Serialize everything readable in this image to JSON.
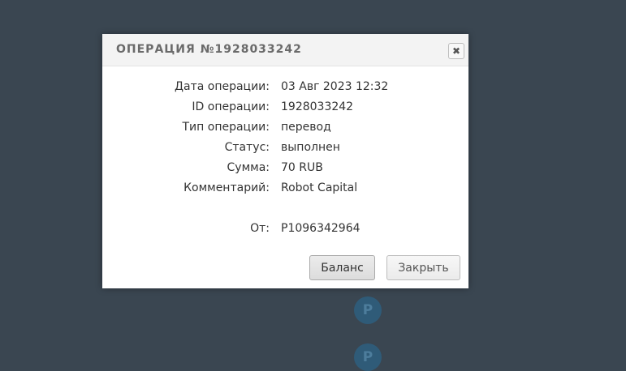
{
  "modal": {
    "title": "ОПЕРАЦИЯ №1928033242",
    "close_glyph": "✖",
    "rows": [
      {
        "label": "Дата операции:",
        "value": "03 Авг 2023 12:32"
      },
      {
        "label": "ID операции:",
        "value": "1928033242"
      },
      {
        "label": "Тип операции:",
        "value": "перевод"
      },
      {
        "label": "Статус:",
        "value": "выполнен"
      },
      {
        "label": "Сумма:",
        "value": "70 RUB"
      },
      {
        "label": "Комментарий:",
        "value": "Robot Capital"
      },
      {
        "label": "От:",
        "value": "P1096342964"
      }
    ],
    "buttons": {
      "balance": "Баланс",
      "close": "Закрыть"
    }
  },
  "colors": {
    "overlay": "#3a4651",
    "modal_bg": "#ffffff",
    "header_bg": "#f3f3f3",
    "title": "#6a6a6a",
    "coin": "#2f5b78"
  }
}
